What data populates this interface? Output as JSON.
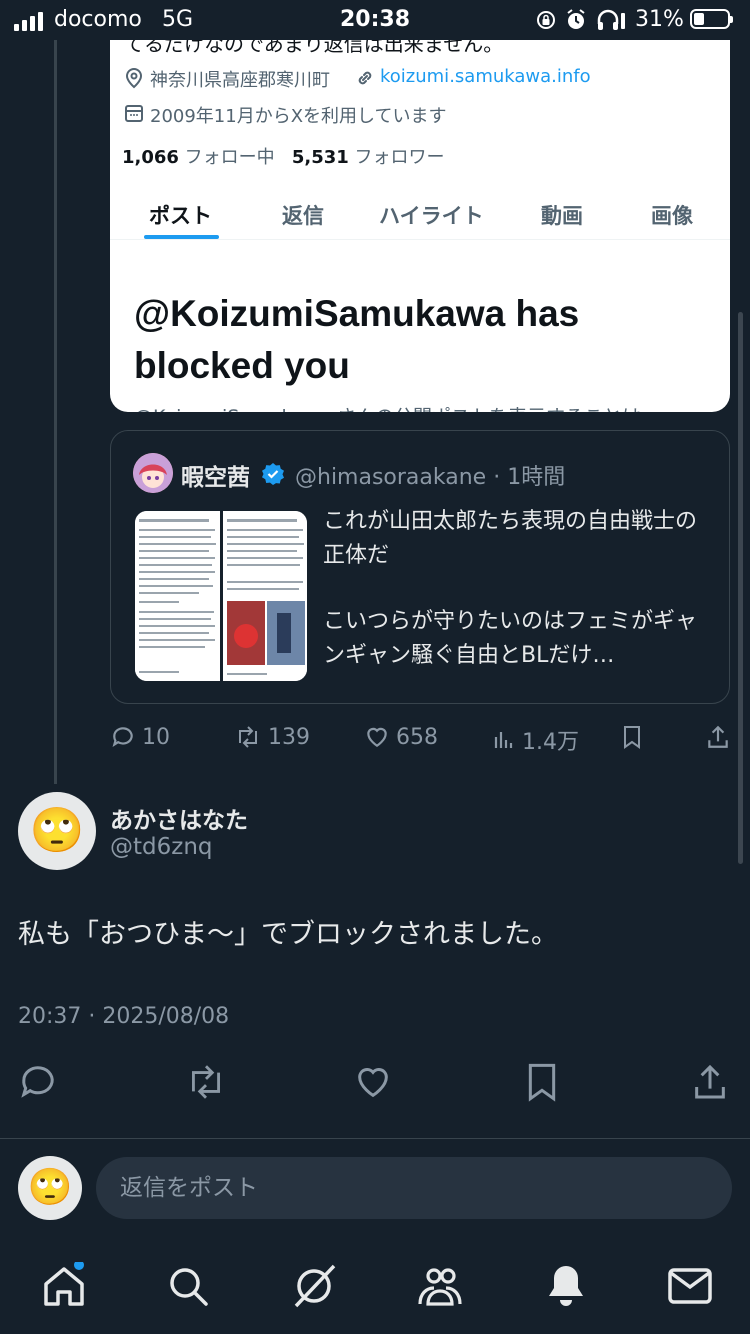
{
  "status_bar": {
    "carrier": "docomo",
    "network": "5G",
    "time": "20:38",
    "battery": "31%",
    "battery_level": 0.31
  },
  "embedded_profile": {
    "bio_fragment": "てるだけなのであまり返信は出来ません。",
    "location": "神奈川県高座郡寒川町",
    "website": "koizumi.samukawa.info",
    "joined": "2009年11月からXを利用しています",
    "following_count": "1,066",
    "following_label": "フォロー中",
    "followers_count": "5,531",
    "followers_label": "フォロワー",
    "tabs": [
      "ポスト",
      "返信",
      "ハイライト",
      "動画",
      "画像"
    ],
    "active_tab": "ポスト",
    "blocked_message": "@KoizumiSamukawa has blocked you",
    "cut_text": "@KoizumiSamukawa さんの公開ポストを表示することは"
  },
  "quote": {
    "display_name": "暇空茜",
    "handle": "@himasoraakane",
    "time": "1時間",
    "text_line1": "これが山田太郎たち表現の自由戦士の正体だ",
    "text_line2": "こいつらが守りたいのはフェミがギャンギャン騒ぐ自由とBLだけ…"
  },
  "actions": {
    "replies": "10",
    "reposts": "139",
    "likes": "658",
    "views": "1.4万"
  },
  "reply": {
    "display_name": "あかさはなた",
    "handle": "@td6znq",
    "text": "私も「おつひま〜」でブロックされました。",
    "timestamp": "20:37 · 2025/08/08",
    "avatar_emoji": "🙄"
  },
  "composer": {
    "placeholder": "返信をポスト",
    "avatar_emoji": "🙄"
  },
  "colors": {
    "background": "#15202b",
    "accent": "#1d9bf0",
    "muted": "#8b98a5"
  },
  "bottom_nav": [
    "home-icon",
    "search-icon",
    "grok-icon",
    "communities-icon",
    "notifications-icon",
    "messages-icon"
  ]
}
